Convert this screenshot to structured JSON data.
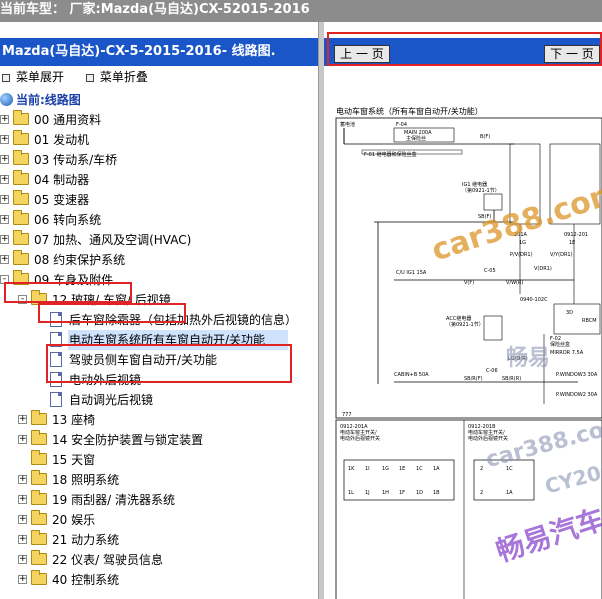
{
  "window": {
    "title": "当前车型： 厂家:Mazda(马自达)CX-52015-2016"
  },
  "left_panel": {
    "header": "Mazda(马自达)-CX-5-2015-2016- 线路图.",
    "expand_label": "菜单展开",
    "collapse_label": "菜单折叠",
    "root_label": "当前:线路图",
    "items": [
      {
        "label": "00 通用资料"
      },
      {
        "label": "01 发动机"
      },
      {
        "label": "03 传动系/车桥"
      },
      {
        "label": "04 制动器"
      },
      {
        "label": "05 变速器"
      },
      {
        "label": "06 转向系统"
      },
      {
        "label": "07 加热、通风及空调(HVAC)"
      },
      {
        "label": "08 约束保护系统"
      },
      {
        "label": "09 车身及附件"
      },
      {
        "label": "12 玻璃/ 车窗/ 后视镜"
      },
      {
        "label": "后车窗除霜器（包括加热外后视镜的信息）"
      },
      {
        "label": "电动车窗系统所有车窗自动开/关功能"
      },
      {
        "label": "驾驶员侧车窗自动开/关功能"
      },
      {
        "label": "电动外后视镜"
      },
      {
        "label": "自动调光后视镜"
      },
      {
        "label": "13 座椅"
      },
      {
        "label": "14 安全防护装置与锁定装置"
      },
      {
        "label": "15 天窗"
      },
      {
        "label": "18 照明系统"
      },
      {
        "label": "19 雨刮器/ 清洗器系统"
      },
      {
        "label": "20 娱乐"
      },
      {
        "label": "21 动力系统"
      },
      {
        "label": "22 仪表/ 驾驶员信息"
      },
      {
        "label": "40 控制系统"
      }
    ]
  },
  "right_panel": {
    "prev_label": "上 一 页",
    "next_label": "下 一 页",
    "diagram_title": "电动车窗系统（所有车窗自动开/关功能）",
    "labels": {
      "battery": "蓄电池",
      "f04": "F-04",
      "main_fuse": "MAIN 200A",
      "main_fuse_box": "主保险丝",
      "b_f": "B(F)",
      "f01": "F-01 继电器和保险丝盒",
      "ig1_relay": "IG1 继电器",
      "ig1_page": "（第0921-1节）",
      "sb_f": "SB(F)",
      "c_u_ig1": "C/U IG1 15A",
      "c05": "C-05",
      "v_f": "V(F)",
      "v_w_r": "V/W(R)",
      "acc_relay": "ACC继电器",
      "acc_page": "（第0921-1节）",
      "cabin": "CABIN+B 50A",
      "sb_r_f": "SB/R(F)",
      "c06": "C-06",
      "sb_r_r": "SB/R(R)",
      "r_w_r": "R/W(R)",
      "c_201a": "201A",
      "c_0912": "0912-201",
      "p_v_dr1": "P/V(DR1)",
      "v_y_dr1": "V/Y(DR1)",
      "v_dr1": "V(DR1)",
      "c_0940": "0940-102C",
      "rbcm": "RBCM",
      "lg_or": "LG/O(R)",
      "f02": "F-02",
      "fuse_box": "保险丝盒",
      "mirror": "MIRROR 7.5A",
      "p_window3": "P.WINDOW3 30A",
      "p_window2": "P.WINDOW2 30A",
      "num_1g": "1G",
      "num_1e": "1E",
      "num_3d": "3D",
      "num_777": "777",
      "c_0912_201a": "0912-201A",
      "c_0912_201b": "0912-201B",
      "switch_a_1": "电动车窗主开关/",
      "switch_a_2": "电动外后视镜开关",
      "switch_b_1": "电动车窗主开关/",
      "switch_b_2": "电动外后视镜开关"
    },
    "connector_a_pins": [
      "1K",
      "1I",
      "1G",
      "1E",
      "1C",
      "1A",
      "1L",
      "1J",
      "1H",
      "1F",
      "1D",
      "1B"
    ],
    "connector_b_pins": [
      "2",
      "1C",
      "2",
      "1A"
    ],
    "watermarks": [
      "car388.com",
      "畅易",
      "car388.com",
      "CY2019",
      "畅易汽车"
    ]
  }
}
